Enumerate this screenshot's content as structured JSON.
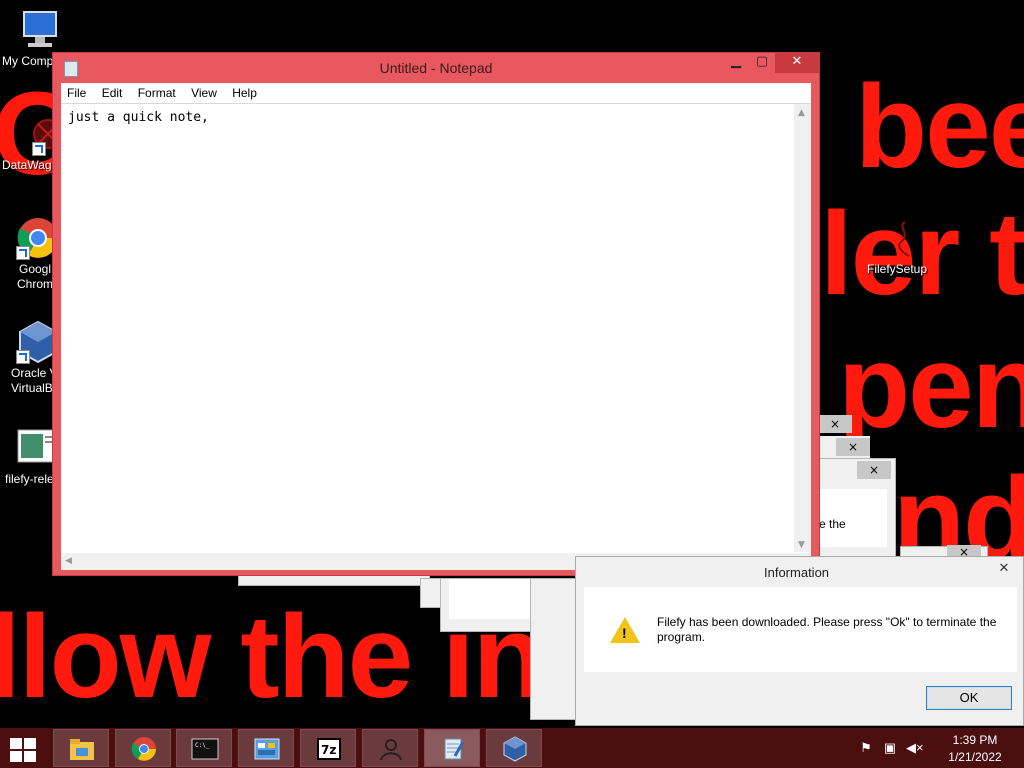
{
  "background": {
    "lines": [
      "Oh",
      "bee",
      "ler t",
      "pen",
      "nd",
      "llow the in"
    ]
  },
  "desktop_icons": [
    {
      "label": "My Comp",
      "icon": "computer-icon"
    },
    {
      "label": "DataWag",
      "icon": "datawag-icon"
    },
    {
      "label": "Googl",
      "label2": "Chrom",
      "icon": "chrome-icon"
    },
    {
      "label": "Oracle V",
      "label2": "VirtualB",
      "icon": "virtualbox-icon"
    },
    {
      "label": "filefy-rele",
      "icon": "document-icon"
    },
    {
      "label": "FilefySetup",
      "icon": "setup-icon"
    }
  ],
  "notepad": {
    "title": "Untitled - Notepad",
    "menu": [
      "File",
      "Edit",
      "Format",
      "View",
      "Help"
    ],
    "content": "just a quick note,",
    "accent": "#e8585f"
  },
  "ghost_dialog": {
    "partial_text": "e the"
  },
  "info_dialog": {
    "title": "Information",
    "message": "Filefy has been downloaded. Please press \"Ok\" to terminate the program.",
    "ok_label": "OK",
    "icon": "warning-icon"
  },
  "taskbar": {
    "apps": [
      "file-explorer-icon",
      "chrome-icon",
      "command-prompt-icon",
      "control-panel-icon",
      "7zip-icon",
      "user-icon",
      "notepad-icon",
      "virtualbox-icon"
    ],
    "time": "1:39 PM",
    "date": "1/21/2022",
    "bg": "#4b0f10"
  }
}
